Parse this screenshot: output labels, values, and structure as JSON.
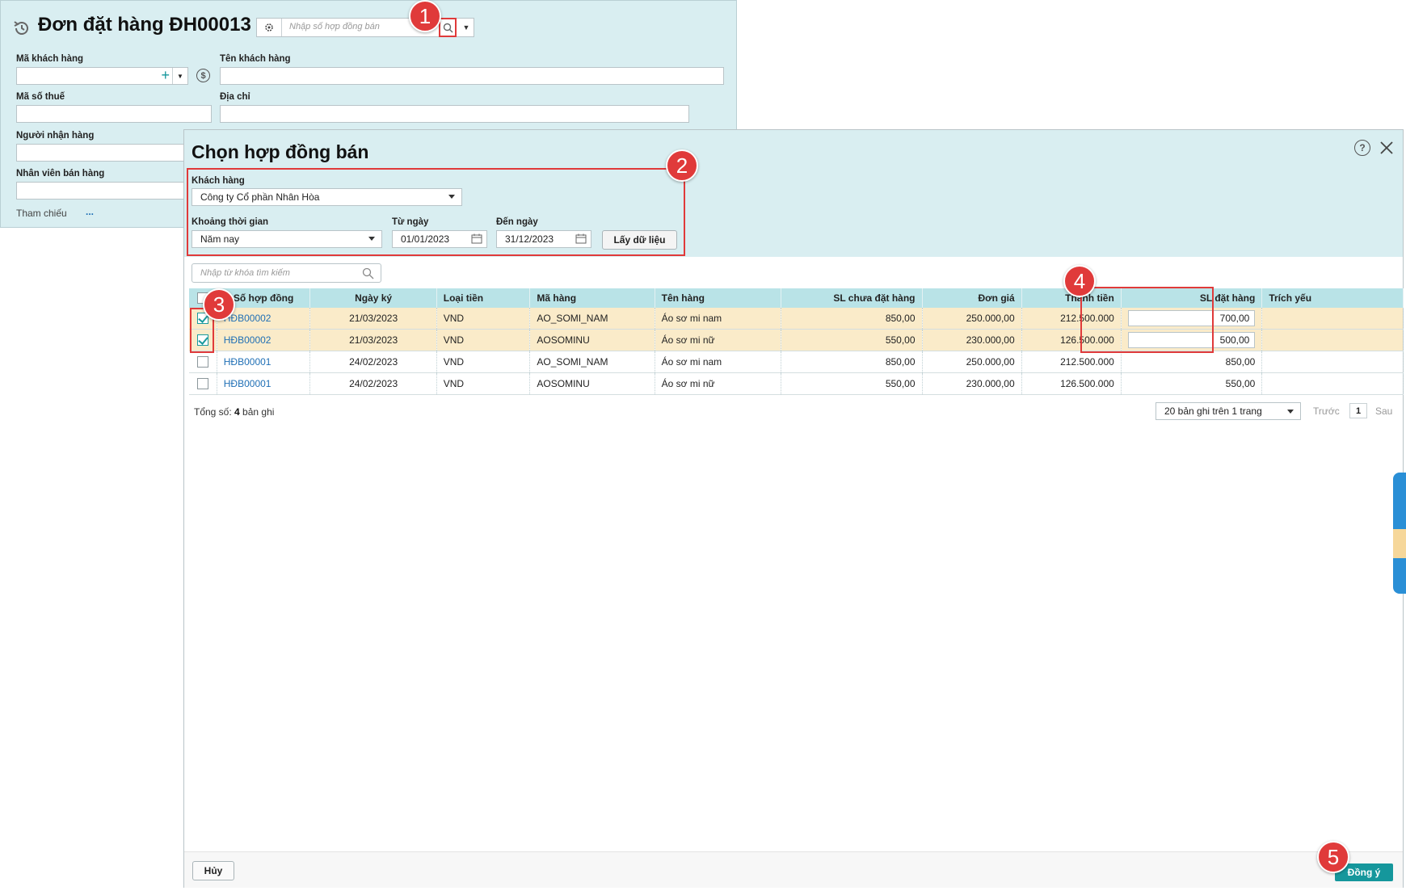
{
  "order_form": {
    "title": "Đơn đặt hàng ĐH00013",
    "contract_search_placeholder": "Nhập số hợp đồng bán",
    "labels": {
      "customer_code": "Mã khách hàng",
      "customer_name": "Tên khách hàng",
      "tax_code": "Mã số thuế",
      "address": "Địa chỉ",
      "receiver": "Người nhận hàng",
      "salesperson": "Nhân viên bán hàng",
      "reference": "Tham chiếu",
      "reference_link": "..."
    }
  },
  "dialog": {
    "title": "Chọn hợp đồng bán",
    "customer_label": "Khách hàng",
    "customer_value": "Công ty Cổ phần Nhân Hòa",
    "period_label": "Khoảng thời gian",
    "period_value": "Năm nay",
    "from_label": "Từ ngày",
    "from_value": "01/01/2023",
    "to_label": "Đến ngày",
    "to_value": "31/12/2023",
    "fetch_button": "Lấy dữ liệu",
    "keyword_placeholder": "Nhập từ khóa tìm kiếm",
    "columns": [
      "Số hợp đồng",
      "Ngày ký",
      "Loại tiền",
      "Mã hàng",
      "Tên hàng",
      "SL chưa đặt hàng",
      "Đơn giá",
      "Thành tiền",
      "SL đặt hàng",
      "Trích yếu"
    ],
    "rows": [
      {
        "checked": true,
        "contract": "HĐB00002",
        "date": "21/03/2023",
        "currency": "VND",
        "code": "AO_SOMI_NAM",
        "name": "Áo sơ mi nam",
        "remaining": "850,00",
        "price": "250.000,00",
        "amount": "212.500.000",
        "qty": "700,00",
        "note": ""
      },
      {
        "checked": true,
        "contract": "HĐB00002",
        "date": "21/03/2023",
        "currency": "VND",
        "code": "AOSOMINU",
        "name": "Áo sơ mi nữ",
        "remaining": "550,00",
        "price": "230.000,00",
        "amount": "126.500.000",
        "qty": "500,00",
        "note": ""
      },
      {
        "checked": false,
        "contract": "HĐB00001",
        "date": "24/02/2023",
        "currency": "VND",
        "code": "AO_SOMI_NAM",
        "name": "Áo sơ mi nam",
        "remaining": "850,00",
        "price": "250.000,00",
        "amount": "212.500.000",
        "qty": "850,00",
        "note": ""
      },
      {
        "checked": false,
        "contract": "HĐB00001",
        "date": "24/02/2023",
        "currency": "VND",
        "code": "AOSOMINU",
        "name": "Áo sơ mi nữ",
        "remaining": "550,00",
        "price": "230.000,00",
        "amount": "126.500.000",
        "qty": "550,00",
        "note": ""
      }
    ],
    "total_prefix": "Tổng số: ",
    "total_count": "4",
    "total_suffix": " bản ghi",
    "page_size": "20 bản ghi trên 1 trang",
    "prev": "Trước",
    "page": "1",
    "next": "Sau",
    "cancel_button": "Hủy",
    "ok_button": "Đồng ý"
  },
  "annotations": [
    "1",
    "2",
    "3",
    "4",
    "5"
  ],
  "colors": {
    "accent": "#15979c",
    "header_bg": "#d9eef1",
    "selected_row": "#faebc9",
    "annotation": "#e03a3a",
    "link": "#1f6fb5"
  }
}
